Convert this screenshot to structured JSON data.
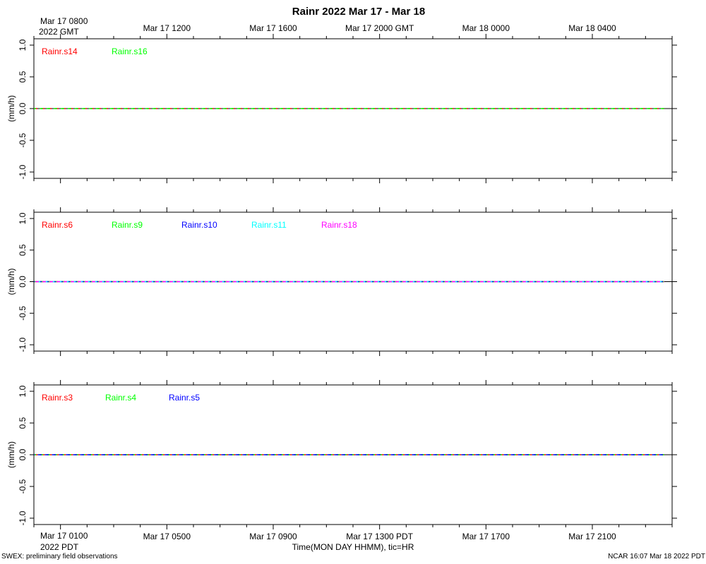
{
  "title": "Rainr 2022 Mar 17 - Mar 18",
  "xlabel": "Time(MON DAY HHMM), tic=HR",
  "footer_left": "SWEX: preliminary field observations",
  "footer_right": "NCAR 16:07 Mar 18 2022 PDT",
  "top_axis": {
    "first_label_line1": "Mar 17 0800",
    "first_label_line2": "2022 GMT",
    "labels": [
      "Mar 17 1200",
      "Mar 17 1600",
      "Mar 17 2000 GMT",
      "Mar 18 0000",
      "Mar 18 0400"
    ]
  },
  "bottom_axis": {
    "first_label_line1": "Mar 17 0100",
    "first_label_line2": "2022 PDT",
    "labels": [
      "Mar 17 0500",
      "Mar 17 0900",
      "Mar 17 1300 PDT",
      "Mar 17 1700",
      "Mar 17 2100"
    ]
  },
  "chart_data": [
    {
      "type": "line",
      "ylabel": "(mm/h)",
      "ylim": [
        -1.1,
        1.1
      ],
      "yticks": [
        "1.0",
        "0.5",
        "0.0",
        "-0.5",
        "-1.0"
      ],
      "series": [
        {
          "name": "Rainr.s14",
          "color": "#ff0000",
          "t_start_hr": 0.0,
          "t_end_hr": 23.7,
          "y": [
            0,
            0
          ]
        },
        {
          "name": "Rainr.s16",
          "color": "#00ff00",
          "t_start_hr": 0.0,
          "t_end_hr": 23.7,
          "y": [
            0,
            0
          ]
        }
      ]
    },
    {
      "type": "line",
      "ylabel": "(mm/h)",
      "ylim": [
        -1.1,
        1.1
      ],
      "yticks": [
        "1.0",
        "0.5",
        "0.0",
        "-0.5",
        "-1.0"
      ],
      "series": [
        {
          "name": "Rainr.s6",
          "color": "#ff0000",
          "t_start_hr": 0.0,
          "t_end_hr": 23.7,
          "y": [
            0,
            0
          ]
        },
        {
          "name": "Rainr.s9",
          "color": "#00ff00",
          "t_start_hr": 0.0,
          "t_end_hr": 23.7,
          "y": [
            0,
            0
          ]
        },
        {
          "name": "Rainr.s10",
          "color": "#0000ff",
          "t_start_hr": 0.0,
          "t_end_hr": 23.7,
          "y": [
            0,
            0
          ]
        },
        {
          "name": "Rainr.s11",
          "color": "#00ffff",
          "t_start_hr": 0.0,
          "t_end_hr": 23.7,
          "y": [
            0,
            0
          ]
        },
        {
          "name": "Rainr.s18",
          "color": "#ff00ff",
          "t_start_hr": 0.0,
          "t_end_hr": 23.7,
          "y": [
            0,
            0
          ]
        }
      ]
    },
    {
      "type": "line",
      "ylabel": "(mm/h)",
      "ylim": [
        -1.1,
        1.1
      ],
      "yticks": [
        "1.0",
        "0.5",
        "0.0",
        "-0.5",
        "-1.0"
      ],
      "series": [
        {
          "name": "Rainr.s3",
          "color": "#ff0000",
          "t_start_hr": 0.0,
          "t_end_hr": 23.7,
          "y": [
            0,
            0
          ]
        },
        {
          "name": "Rainr.s4",
          "color": "#00ff00",
          "t_start_hr": 0.0,
          "t_end_hr": 23.7,
          "y": [
            0,
            0
          ]
        },
        {
          "name": "Rainr.s5",
          "color": "#0000ff",
          "t_start_hr": 0.0,
          "t_end_hr": 23.7,
          "y": [
            0,
            0
          ]
        }
      ]
    }
  ]
}
